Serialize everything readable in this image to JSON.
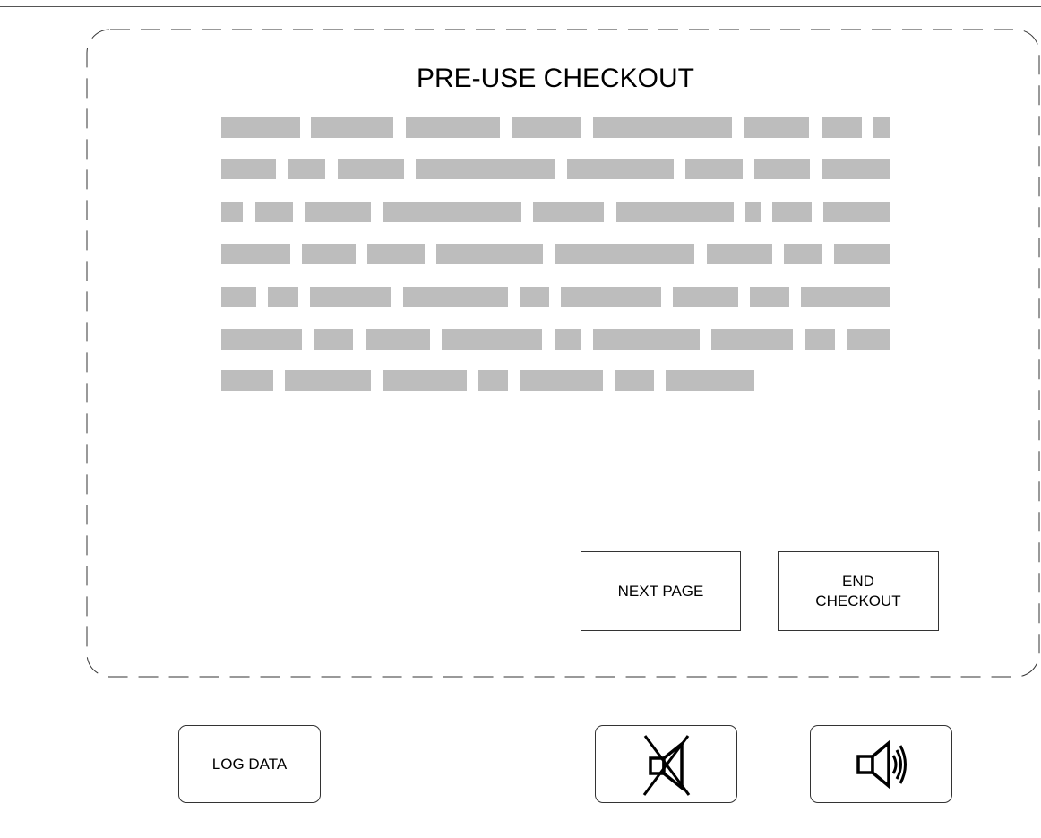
{
  "checkout": {
    "title": "PRE-USE CHECKOUT",
    "next_page_label": "NEXT PAGE",
    "end_checkout_label_line1": "END",
    "end_checkout_label_line2": "CHECKOUT"
  },
  "footer": {
    "log_data_label": "LOG DATA",
    "mute_icon": "speaker-muted-icon",
    "sound_icon": "speaker-sound-icon"
  },
  "colors": {
    "redacted_block": "#bdbdbd",
    "border": "#333333",
    "background": "#ffffff"
  }
}
